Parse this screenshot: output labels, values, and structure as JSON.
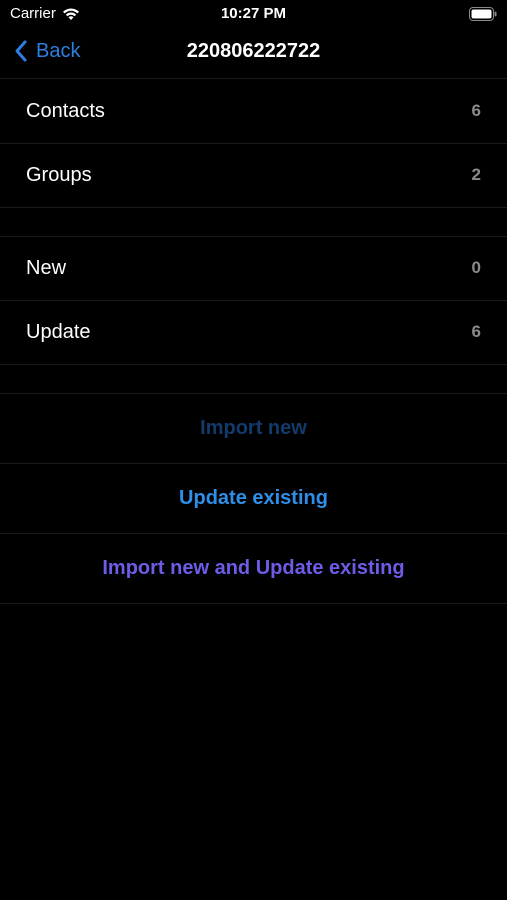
{
  "status_bar": {
    "carrier": "Carrier",
    "time": "10:27 PM",
    "icons": [
      "wifi-icon",
      "battery-icon"
    ]
  },
  "nav": {
    "back_label": "Back",
    "title": "220806222722"
  },
  "summary": [
    {
      "label": "Contacts",
      "value": "6"
    },
    {
      "label": "Groups",
      "value": "2"
    }
  ],
  "changes": [
    {
      "label": "New",
      "value": "0"
    },
    {
      "label": "Update",
      "value": "6"
    }
  ],
  "actions": [
    {
      "label": "Import new",
      "color": "#123a6b",
      "enabled": false
    },
    {
      "label": "Update existing",
      "color": "#2f8ee8",
      "enabled": true
    },
    {
      "label": "Import new and Update existing",
      "color": "#6c5ce7",
      "enabled": true
    }
  ],
  "colors": {
    "background": "#000000",
    "accent": "#2f7fe0",
    "secondary_text": "#8a8a8a",
    "separator": "#1a1a1a"
  }
}
